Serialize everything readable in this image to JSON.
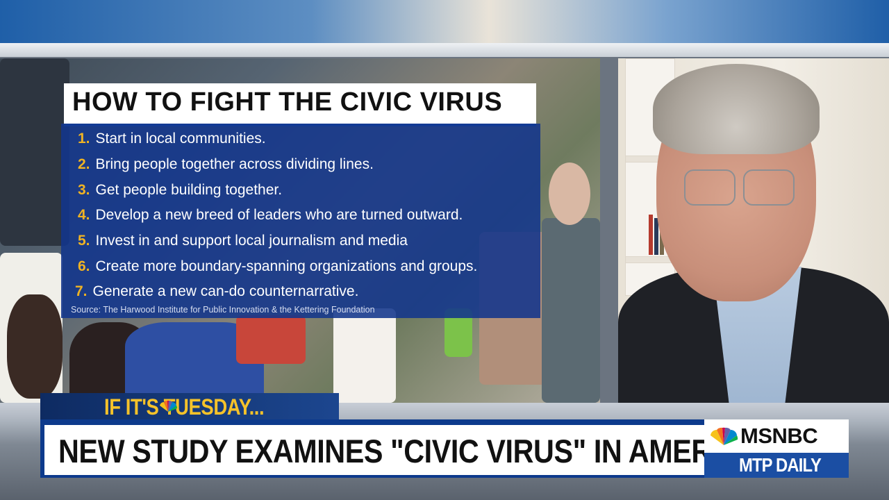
{
  "graphic": {
    "title": "HOW TO FIGHT THE CIVIC VIRUS",
    "items": [
      {
        "num": "1.",
        "text": "Start in local communities."
      },
      {
        "num": "2.",
        "text": "Bring people together across dividing lines."
      },
      {
        "num": "3.",
        "text": "Get people building together."
      },
      {
        "num": "4.",
        "text": "Develop a new breed of leaders who are turned outward."
      },
      {
        "num": "5.",
        "text": "Invest in and support local journalism and media"
      },
      {
        "num": "6.",
        "text": "Create more boundary-spanning organizations and groups."
      },
      {
        "num": "7.",
        "text": "Generate a new can-do counternarrative."
      }
    ],
    "source": "Source: The Harwood Institute for Public Innovation & the Kettering Foundation"
  },
  "lower_third": {
    "show_tag": "IF IT'S TUESDAY...",
    "headline": "NEW STUDY EXAMINES \"CIVIC VIRUS\" IN AMERICA"
  },
  "brand": {
    "network": "MSNBC",
    "program": "MTP DAILY"
  },
  "colors": {
    "card_blue": "#12368c",
    "number_gold": "#f0b323",
    "lower_third_blue": "#0d3a8c",
    "tag_yellow": "#f5c22a"
  }
}
